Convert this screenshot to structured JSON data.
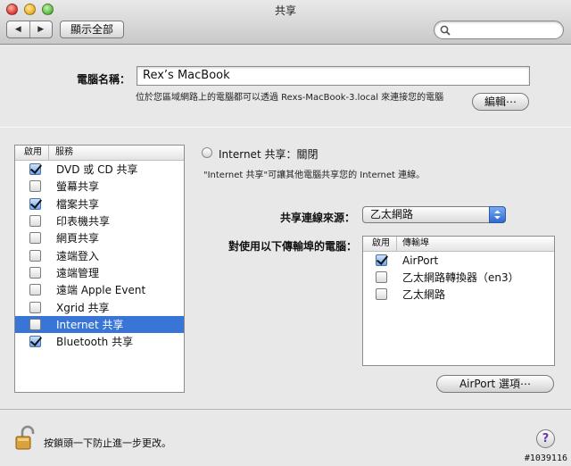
{
  "window": {
    "title": "共享"
  },
  "toolbar": {
    "back_label": "◀",
    "forward_label": "▶",
    "show_all_label": "顯示全部",
    "search_placeholder": ""
  },
  "computer_name": {
    "label": "電腦名稱：",
    "value": "Rex’s MacBook",
    "subtitle": "位於您區域網路上的電腦都可以透過 Rexs-MacBook-3.local 來連接您的電腦",
    "edit_label": "編輯⋯"
  },
  "services": {
    "header_enabled": "啟用",
    "header_service": "服務",
    "items": [
      {
        "label": "DVD 或 CD 共享",
        "checked": true,
        "selected": false
      },
      {
        "label": "螢幕共享",
        "checked": false,
        "selected": false
      },
      {
        "label": "檔案共享",
        "checked": true,
        "selected": false
      },
      {
        "label": "印表機共享",
        "checked": false,
        "selected": false
      },
      {
        "label": "網頁共享",
        "checked": false,
        "selected": false
      },
      {
        "label": "遠端登入",
        "checked": false,
        "selected": false
      },
      {
        "label": "遠端管理",
        "checked": false,
        "selected": false
      },
      {
        "label": "遠端 Apple Event",
        "checked": false,
        "selected": false
      },
      {
        "label": "Xgrid 共享",
        "checked": false,
        "selected": false
      },
      {
        "label": "Internet 共享",
        "checked": false,
        "selected": true
      },
      {
        "label": "Bluetooth 共享",
        "checked": true,
        "selected": false
      }
    ]
  },
  "detail": {
    "status": "Internet 共享：關閉",
    "description": "\"Internet 共享\"可讓其他電腦共享您的 Internet 連線。",
    "source_label": "共享連線來源：",
    "source_value": "乙太網路",
    "ports_label": "對使用以下傳輸埠的電腦：",
    "ports_header_enabled": "啟用",
    "ports_header_port": "傳輸埠",
    "ports": [
      {
        "label": "AirPort",
        "checked": true
      },
      {
        "label": "乙太網路轉換器（en3）",
        "checked": false
      },
      {
        "label": "乙太網路",
        "checked": false
      }
    ],
    "airport_options_label": "AirPort 選項⋯"
  },
  "footer": {
    "lock_text": "按鎖頭一下防止進一步更改。",
    "help_label": "?",
    "watermark": "#1039116"
  },
  "colors": {
    "selection": "#3875d7",
    "window_bg": "#e8e8e8"
  }
}
